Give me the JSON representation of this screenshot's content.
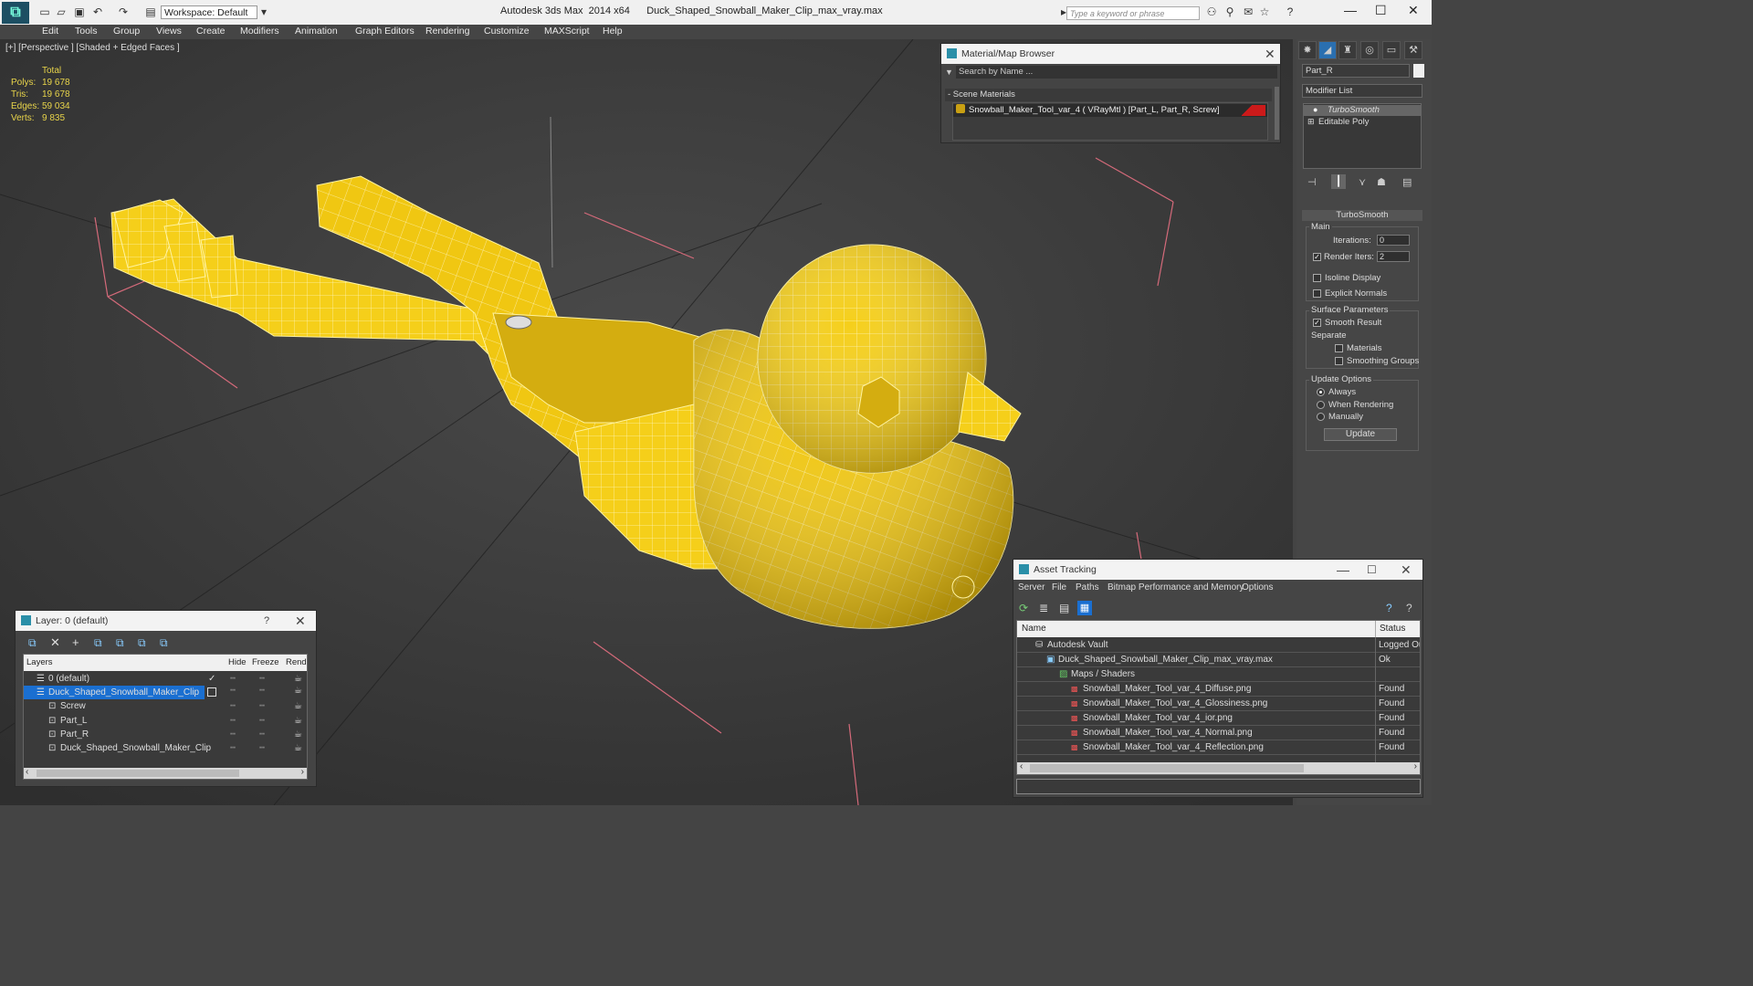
{
  "window": {
    "app_title": "Autodesk 3ds Max  2014 x64",
    "file_title": "Duck_Shaped_Snowball_Maker_Clip_max_vray.max",
    "workspace": "Workspace: Default",
    "search_placeholder": "Type a keyword or phrase"
  },
  "menu": [
    "Edit",
    "Tools",
    "Group",
    "Views",
    "Create",
    "Modifiers",
    "Animation",
    "Graph Editors",
    "Rendering",
    "Customize",
    "MAXScript",
    "Help"
  ],
  "viewport": {
    "label": "[+] [Perspective ] [Shaded + Edged Faces ]",
    "stats": {
      "header": "Total",
      "rows": [
        {
          "label": "Polys:",
          "value": "19 678"
        },
        {
          "label": "Tris:",
          "value": "19 678"
        },
        {
          "label": "Edges:",
          "value": "59 034"
        },
        {
          "label": "Verts:",
          "value": "9 835"
        }
      ]
    }
  },
  "material_browser": {
    "title": "Material/Map Browser",
    "search_placeholder": "Search by Name ...",
    "section": "- Scene Materials",
    "item": "Snowball_Maker_Tool_var_4  ( VRayMtl )  [Part_L, Part_R, Screw]"
  },
  "command_panel": {
    "object_name": "Part_R",
    "modifier_list": "Modifier List",
    "stack": [
      "TurboSmooth",
      "Editable Poly"
    ],
    "rollout_title": "TurboSmooth",
    "main_label": "Main",
    "iterations_label": "Iterations:",
    "iterations_value": "0",
    "render_iters_label": "Render Iters:",
    "render_iters_value": "2",
    "isoline": "Isoline Display",
    "explicit_normals": "Explicit Normals",
    "surface_params": "Surface Parameters",
    "smooth_result": "Smooth Result",
    "separate": "Separate",
    "materials": "Materials",
    "smoothing_groups": "Smoothing Groups",
    "update_options": "Update Options",
    "always": "Always",
    "when_rendering": "When Rendering",
    "manually": "Manually",
    "update_button": "Update"
  },
  "layer_panel": {
    "title": "Layer: 0 (default)",
    "columns": [
      "Layers",
      "Hide",
      "Freeze",
      "Rende"
    ],
    "rows": [
      {
        "name": "0 (default)"
      },
      {
        "name": "Duck_Shaped_Snowball_Maker_Clip"
      },
      {
        "name": "Screw"
      },
      {
        "name": "Part_L"
      },
      {
        "name": "Part_R"
      },
      {
        "name": "Duck_Shaped_Snowball_Maker_Clip"
      }
    ]
  },
  "asset_tracking": {
    "title": "Asset Tracking",
    "menu": [
      "Server",
      "File",
      "Paths",
      "Bitmap Performance and Memory",
      "Options"
    ],
    "columns": [
      "Name",
      "Status"
    ],
    "rows": [
      {
        "name": "Autodesk Vault",
        "status": "Logged Ou"
      },
      {
        "name": "Duck_Shaped_Snowball_Maker_Clip_max_vray.max",
        "status": "Ok"
      },
      {
        "name": "Maps / Shaders",
        "status": ""
      },
      {
        "name": "Snowball_Maker_Tool_var_4_Diffuse.png",
        "status": "Found"
      },
      {
        "name": "Snowball_Maker_Tool_var_4_Glossiness.png",
        "status": "Found"
      },
      {
        "name": "Snowball_Maker_Tool_var_4_ior.png",
        "status": "Found"
      },
      {
        "name": "Snowball_Maker_Tool_var_4_Normal.png",
        "status": "Found"
      },
      {
        "name": "Snowball_Maker_Tool_var_4_Reflection.png",
        "status": "Found"
      }
    ]
  },
  "colors": {
    "model_yellow": "#f5cf1a",
    "selection_blue": "#1a6fd1",
    "stats_yellow": "#e8d44a"
  }
}
